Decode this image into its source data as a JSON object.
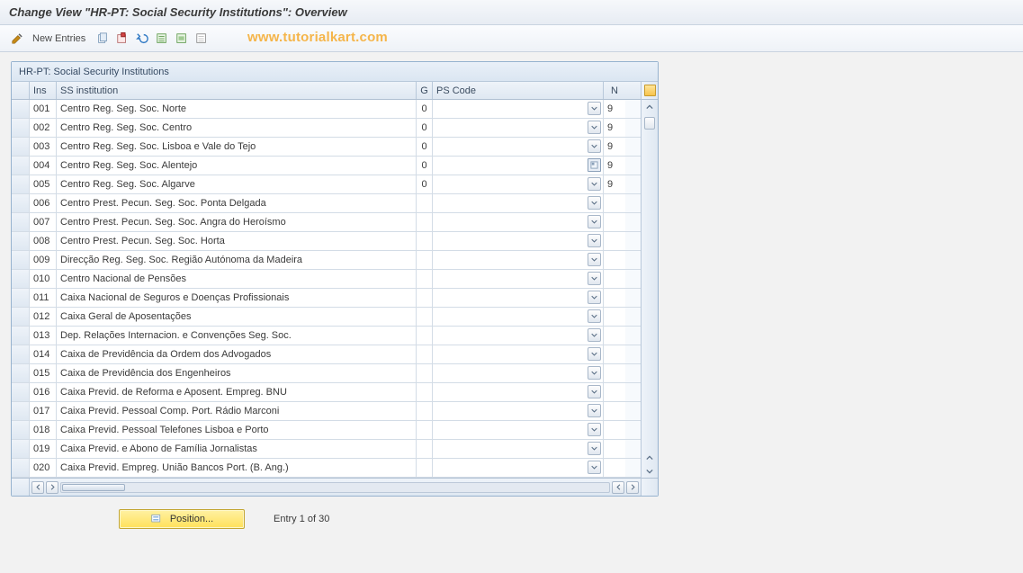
{
  "title": "Change View \"HR-PT: Social Security Institutions\": Overview",
  "toolbar": {
    "new_entries": "New Entries"
  },
  "watermark": "www.tutorialkart.com",
  "panel_title": "HR-PT: Social Security Institutions",
  "columns": {
    "ins": "Ins",
    "ss_institution": "SS institution",
    "g": "G",
    "ps_code": "PS Code",
    "n": "N"
  },
  "position_button": "Position...",
  "entry_text": "Entry 1 of 30",
  "rows": [
    {
      "ins": "001",
      "ssi": "Centro Reg. Seg. Soc. Norte",
      "g": "0",
      "dd": "dd",
      "n": "9"
    },
    {
      "ins": "002",
      "ssi": "Centro Reg. Seg. Soc. Centro",
      "g": "0",
      "dd": "dd",
      "n": "9"
    },
    {
      "ins": "003",
      "ssi": "Centro Reg. Seg. Soc. Lisboa e Vale do Tejo",
      "g": "0",
      "dd": "dd",
      "n": "9"
    },
    {
      "ins": "004",
      "ssi": "Centro Reg. Seg. Soc. Alentejo",
      "g": "0",
      "dd": "f4",
      "n": "9"
    },
    {
      "ins": "005",
      "ssi": "Centro Reg. Seg. Soc. Algarve",
      "g": "0",
      "dd": "dd",
      "n": "9"
    },
    {
      "ins": "006",
      "ssi": "Centro Prest. Pecun. Seg. Soc. Ponta Delgada",
      "g": "",
      "dd": "dd",
      "n": ""
    },
    {
      "ins": "007",
      "ssi": "Centro Prest. Pecun. Seg. Soc. Angra do Heroísmo",
      "g": "",
      "dd": "dd",
      "n": ""
    },
    {
      "ins": "008",
      "ssi": "Centro Prest. Pecun. Seg. Soc. Horta",
      "g": "",
      "dd": "dd",
      "n": ""
    },
    {
      "ins": "009",
      "ssi": "Direcção Reg. Seg. Soc. Região Autónoma da Madeira",
      "g": "",
      "dd": "dd",
      "n": ""
    },
    {
      "ins": "010",
      "ssi": "Centro Nacional de Pensões",
      "g": "",
      "dd": "dd",
      "n": ""
    },
    {
      "ins": "011",
      "ssi": "Caixa Nacional de Seguros e Doenças Profissionais",
      "g": "",
      "dd": "dd",
      "n": ""
    },
    {
      "ins": "012",
      "ssi": "Caixa Geral de Aposentações",
      "g": "",
      "dd": "dd",
      "n": ""
    },
    {
      "ins": "013",
      "ssi": "Dep. Relações Internacion. e Convenções Seg. Soc.",
      "g": "",
      "dd": "dd",
      "n": ""
    },
    {
      "ins": "014",
      "ssi": "Caixa de Previdência da Ordem dos Advogados",
      "g": "",
      "dd": "dd",
      "n": ""
    },
    {
      "ins": "015",
      "ssi": "Caixa de Previdência dos Engenheiros",
      "g": "",
      "dd": "dd",
      "n": ""
    },
    {
      "ins": "016",
      "ssi": "Caixa Previd. de Reforma e Aposent. Empreg. BNU",
      "g": "",
      "dd": "dd",
      "n": ""
    },
    {
      "ins": "017",
      "ssi": "Caixa Previd. Pessoal Comp. Port. Rádio Marconi",
      "g": "",
      "dd": "dd",
      "n": ""
    },
    {
      "ins": "018",
      "ssi": "Caixa Previd. Pessoal Telefones Lisboa e Porto",
      "g": "",
      "dd": "dd",
      "n": ""
    },
    {
      "ins": "019",
      "ssi": "Caixa Previd. e Abono de Família Jornalistas",
      "g": "",
      "dd": "dd",
      "n": ""
    },
    {
      "ins": "020",
      "ssi": "Caixa Previd. Empreg. União Bancos Port. (B. Ang.)",
      "g": "",
      "dd": "dd",
      "n": ""
    }
  ]
}
